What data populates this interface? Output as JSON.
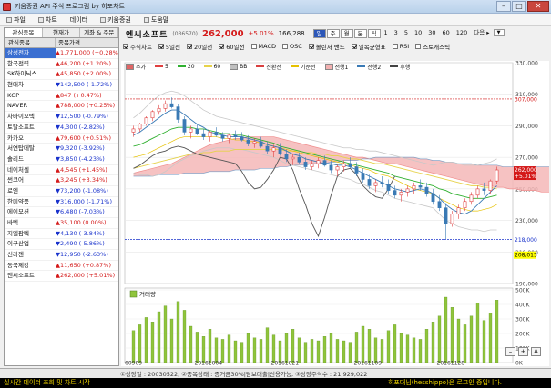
{
  "window": {
    "title": "키움증권 API 주식 프로그램 by 히포차트"
  },
  "menu": [
    {
      "icon": "file-icon",
      "label": "파일"
    },
    {
      "icon": "chart-icon",
      "label": "차트"
    },
    {
      "icon": "data-icon",
      "label": "데이터"
    },
    {
      "icon": "kiwoom-icon",
      "label": "키움증권"
    },
    {
      "icon": "help-icon",
      "label": "도움말"
    }
  ],
  "left": {
    "tabs": [
      "관심종목",
      "현재가",
      "계좌 & 주문"
    ],
    "columns": [
      "관심종목",
      "종목가격"
    ],
    "rows": [
      {
        "name": "삼성전자",
        "price": "▲1,771,000 (+0.28%)",
        "dir": "up",
        "selected": true
      },
      {
        "name": "한국전력",
        "price": "▲46,200 (+1.20%)",
        "dir": "up"
      },
      {
        "name": "SK하이닉스",
        "price": "▲45,850 (+2.00%)",
        "dir": "up"
      },
      {
        "name": "현대차",
        "price": "▼142,500 (-1.72%)",
        "dir": "dn"
      },
      {
        "name": "KGP",
        "price": "▲847 (+0.47%)",
        "dir": "up"
      },
      {
        "name": "NAVER",
        "price": "▲788,000 (+0.25%)",
        "dir": "up"
      },
      {
        "name": "차바이오텍",
        "price": "▼12,500 (-0.79%)",
        "dir": "dn"
      },
      {
        "name": "토탈소프트",
        "price": "▼4,300 (-2.82%)",
        "dir": "dn"
      },
      {
        "name": "카카오",
        "price": "▲79,600 (+0.51%)",
        "dir": "up"
      },
      {
        "name": "서연탑메탈",
        "price": "▼9,320 (-3.92%)",
        "dir": "dn"
      },
      {
        "name": "솔리드",
        "price": "▼3,850 (-4.23%)",
        "dir": "dn"
      },
      {
        "name": "네이처셀",
        "price": "▲4,545 (+1.45%)",
        "dir": "up"
      },
      {
        "name": "썬코어",
        "price": "▲3,245 (+3.34%)",
        "dir": "up"
      },
      {
        "name": "로엔",
        "price": "▼73,200 (-1.08%)",
        "dir": "dn"
      },
      {
        "name": "한미약품",
        "price": "▼316,000 (-1.71%)",
        "dir": "dn"
      },
      {
        "name": "에이모션",
        "price": "▼6,480 (-7.03%)",
        "dir": "dn"
      },
      {
        "name": "바텍",
        "price": "▲35,100 (0.00%)",
        "dir": "up"
      },
      {
        "name": "지엘팜텍",
        "price": "▼4,130 (-3.84%)",
        "dir": "dn"
      },
      {
        "name": "이구산업",
        "price": "▼2,490 (-5.86%)",
        "dir": "dn"
      },
      {
        "name": "신라젠",
        "price": "▼12,950 (-2.63%)",
        "dir": "dn"
      },
      {
        "name": "동국제강",
        "price": "▲11,650 (+0.87%)",
        "dir": "up"
      },
      {
        "name": "엔씨소프트",
        "price": "▲262,000 (+5.01%)",
        "dir": "up"
      }
    ]
  },
  "header": {
    "name": "엔씨소프트",
    "code": "(036570)",
    "price": "262,000",
    "change": "+5.01%",
    "volume": "166,288",
    "periods": [
      "일",
      "주",
      "월",
      "분",
      "틱"
    ],
    "minutes": [
      "1",
      "3",
      "5",
      "10",
      "30",
      "60",
      "120"
    ],
    "after": "다음 ▸"
  },
  "options": [
    {
      "label": "주식차트",
      "on": true
    },
    {
      "label": "5일선",
      "on": true
    },
    {
      "label": "20일선",
      "on": true
    },
    {
      "label": "60일선",
      "on": true
    },
    {
      "label": "MACD",
      "on": false
    },
    {
      "label": "OSC",
      "on": false
    },
    {
      "label": "볼린저 밴드",
      "on": true
    },
    {
      "label": "일목균형표",
      "on": true
    },
    {
      "label": "RSI",
      "on": false
    },
    {
      "label": "스토캐스틱",
      "on": false
    }
  ],
  "legend": [
    {
      "label": "주가",
      "color": "#e06666",
      "kind": "box"
    },
    {
      "label": "5",
      "color": "#e04040"
    },
    {
      "label": "20",
      "color": "#30b030"
    },
    {
      "label": "60",
      "color": "#e6d24a"
    },
    {
      "label": "BB",
      "color": "#c0c0c0",
      "kind": "box"
    },
    {
      "label": "전환선",
      "color": "#d94040"
    },
    {
      "label": "기준선",
      "color": "#e6c100"
    },
    {
      "label": "선행1",
      "color": "#f3b1b1",
      "kind": "box"
    },
    {
      "label": "선행2",
      "color": "#3a7ab5"
    },
    {
      "label": "후행",
      "color": "#444444"
    }
  ],
  "chart_data": {
    "type": "candlestick",
    "ylim": [
      190000,
      330000
    ],
    "yticks": [
      "330,000",
      "310,000",
      "290,000",
      "270,000",
      "250,000",
      "230,000",
      "210,000",
      "190,000"
    ],
    "xticks": [
      "60909",
      "20161004",
      "20161021",
      "20161109",
      "20161128"
    ],
    "ref_lines": [
      {
        "label": "307,000",
        "value": 307000,
        "color": "#d41a1a"
      },
      {
        "label": "218,000",
        "value": 218000,
        "color": "#1a33cc"
      }
    ],
    "price_tags": [
      {
        "label": "262,000",
        "sub": "+5.01%",
        "value": 262000,
        "bg": "#d41a1a",
        "fg": "#ffffff"
      },
      {
        "label": "208,015",
        "value": 208015,
        "bg": "#ffff00",
        "fg": "#000000"
      }
    ],
    "candles": [
      [
        286000,
        290000,
        283000,
        288000
      ],
      [
        288000,
        292000,
        286000,
        291000
      ],
      [
        291000,
        296000,
        290000,
        295000
      ],
      [
        295000,
        300000,
        293000,
        299000
      ],
      [
        299000,
        303000,
        297000,
        301000
      ],
      [
        301000,
        306000,
        299000,
        304000
      ],
      [
        304000,
        308000,
        301000,
        302000
      ],
      [
        302000,
        304000,
        292000,
        294000
      ],
      [
        294000,
        296000,
        284000,
        286000
      ],
      [
        286000,
        290000,
        282000,
        288000
      ],
      [
        288000,
        291000,
        284000,
        285000
      ],
      [
        285000,
        288000,
        281000,
        283000
      ],
      [
        283000,
        287000,
        280000,
        286000
      ],
      [
        286000,
        289000,
        283000,
        284000
      ],
      [
        284000,
        286000,
        280000,
        282000
      ],
      [
        282000,
        285000,
        279000,
        284000
      ],
      [
        284000,
        287000,
        281000,
        283000
      ],
      [
        283000,
        286000,
        280000,
        281000
      ],
      [
        281000,
        284000,
        277000,
        279000
      ],
      [
        279000,
        282000,
        276000,
        280000
      ],
      [
        280000,
        283000,
        276000,
        277000
      ],
      [
        277000,
        280000,
        272000,
        274000
      ],
      [
        274000,
        278000,
        270000,
        276000
      ],
      [
        276000,
        279000,
        271000,
        272000
      ],
      [
        272000,
        275000,
        267000,
        269000
      ],
      [
        269000,
        272000,
        265000,
        270000
      ],
      [
        270000,
        273000,
        266000,
        267000
      ],
      [
        267000,
        270000,
        262000,
        264000
      ],
      [
        264000,
        268000,
        262000,
        266000
      ],
      [
        266000,
        270000,
        263000,
        268000
      ],
      [
        268000,
        271000,
        264000,
        265000
      ],
      [
        265000,
        268000,
        260000,
        262000
      ],
      [
        262000,
        266000,
        258000,
        264000
      ],
      [
        264000,
        268000,
        261000,
        266000
      ],
      [
        266000,
        270000,
        263000,
        264000
      ],
      [
        264000,
        267000,
        258000,
        260000
      ],
      [
        260000,
        263000,
        254000,
        256000
      ],
      [
        256000,
        259000,
        250000,
        252000
      ],
      [
        252000,
        256000,
        248000,
        254000
      ],
      [
        254000,
        258000,
        251000,
        253000
      ],
      [
        253000,
        256000,
        247000,
        249000
      ],
      [
        249000,
        252000,
        244000,
        246000
      ],
      [
        246000,
        250000,
        242000,
        248000
      ],
      [
        248000,
        252000,
        245000,
        250000
      ],
      [
        250000,
        254000,
        247000,
        252000
      ],
      [
        252000,
        256000,
        249000,
        251000
      ],
      [
        251000,
        254000,
        245000,
        247000
      ],
      [
        247000,
        250000,
        240000,
        242000
      ],
      [
        242000,
        246000,
        236000,
        238000
      ],
      [
        238000,
        241000,
        218000,
        228000
      ],
      [
        228000,
        236000,
        226000,
        234000
      ],
      [
        234000,
        240000,
        231000,
        238000
      ],
      [
        238000,
        244000,
        236000,
        242000
      ],
      [
        242000,
        248000,
        240000,
        246000
      ],
      [
        246000,
        252000,
        244000,
        250000
      ],
      [
        250000,
        254000,
        246000,
        249000
      ],
      [
        249000,
        256000,
        247000,
        255000
      ],
      [
        255000,
        264000,
        253000,
        262000
      ]
    ],
    "ma5": [
      284000,
      286000,
      289000,
      292000,
      295000,
      298000,
      300000,
      300000,
      297000,
      294000,
      291000,
      289000,
      286000,
      285000,
      284000,
      283000,
      283000,
      283000,
      282000,
      281000,
      280000,
      278000,
      277000,
      276000,
      274000,
      272000,
      271000,
      269000,
      268000,
      267000,
      266000,
      266000,
      265000,
      265000,
      264000,
      262000,
      260000,
      258000,
      256000,
      254000,
      252000,
      250000,
      249000,
      248000,
      249000,
      250000,
      249000,
      247000,
      244000,
      240000,
      237000,
      235000,
      234000,
      236000,
      240000,
      244000,
      248000,
      252000
    ],
    "ma20": [
      277000,
      278000,
      280000,
      282000,
      284000,
      286000,
      288000,
      289000,
      289000,
      289000,
      288000,
      288000,
      287000,
      286000,
      285000,
      285000,
      284000,
      284000,
      283000,
      282000,
      281000,
      280000,
      279000,
      277000,
      276000,
      275000,
      274000,
      273000,
      272000,
      271000,
      270000,
      269000,
      268000,
      267000,
      266000,
      265000,
      264000,
      263000,
      262000,
      261000,
      260000,
      258000,
      257000,
      256000,
      255000,
      254000,
      253000,
      252000,
      250000,
      249000,
      247000,
      246000,
      245000,
      244000,
      244000,
      244000,
      245000,
      246000
    ],
    "ma60": [
      263000,
      264000,
      265000,
      266000,
      267000,
      268000,
      269000,
      270000,
      271000,
      272000,
      272000,
      273000,
      273000,
      274000,
      274000,
      274000,
      275000,
      275000,
      275000,
      275000,
      275000,
      275000,
      275000,
      275000,
      274000,
      274000,
      274000,
      273000,
      273000,
      272000,
      272000,
      271000,
      271000,
      270000,
      269000,
      269000,
      268000,
      267000,
      266000,
      266000,
      265000,
      264000,
      263000,
      262000,
      261000,
      260000,
      259000,
      258000,
      257000,
      256000,
      255000,
      254000,
      253000,
      252000,
      252000,
      251000,
      251000,
      250000
    ],
    "bb_upper": [
      295000,
      298000,
      302000,
      306000,
      309000,
      311000,
      312000,
      311000,
      309000,
      306000,
      303000,
      300000,
      298000,
      296000,
      295000,
      294000,
      293000,
      292000,
      291000,
      290000,
      289000,
      288000,
      287000,
      286000,
      285000,
      284000,
      283000,
      282000,
      281000,
      280000,
      279000,
      278000,
      277000,
      276000,
      276000,
      275000,
      275000,
      274000,
      274000,
      273000,
      272000,
      271000,
      270000,
      269000,
      268000,
      267000,
      266000,
      265000,
      266000,
      267000,
      267000,
      266000,
      265000,
      265000,
      265000,
      266000,
      267000,
      269000
    ],
    "bb_lower": [
      260000,
      259000,
      259000,
      258000,
      259000,
      261000,
      264000,
      267000,
      269000,
      271000,
      272000,
      274000,
      275000,
      276000,
      276000,
      276000,
      275000,
      275000,
      274000,
      273000,
      272000,
      271000,
      270000,
      268000,
      266000,
      265000,
      264000,
      263000,
      262000,
      261000,
      260000,
      259000,
      258000,
      257000,
      256000,
      254000,
      253000,
      251000,
      249000,
      248000,
      246000,
      244000,
      243000,
      242000,
      241000,
      240000,
      239000,
      238000,
      234000,
      230000,
      228000,
      226000,
      225000,
      224000,
      224000,
      223000,
      224000,
      224000
    ],
    "kijun": [
      270000,
      271000,
      272000,
      274000,
      276000,
      278000,
      280000,
      282000,
      283000,
      283000,
      283000,
      283000,
      283000,
      283000,
      282000,
      282000,
      281000,
      281000,
      280000,
      280000,
      279000,
      278000,
      277000,
      276000,
      275000,
      274000,
      273000,
      272000,
      271000,
      270000,
      269000,
      268000,
      267000,
      266000,
      265000,
      264000,
      263000,
      262000,
      260000,
      259000,
      258000,
      256000,
      254000,
      252000,
      250000,
      249000,
      248000,
      247000,
      244000,
      242000,
      240000,
      238000,
      237000,
      236000,
      236000,
      237000,
      238000,
      240000
    ],
    "chikou": [
      263000,
      265000,
      268000,
      271000,
      273000,
      274000,
      276000,
      277000,
      276000,
      274000,
      272000,
      271000,
      270000,
      269000,
      268000,
      267000,
      266000,
      261000,
      254000,
      250000,
      251000,
      256000,
      262000,
      270000,
      269000,
      262000,
      250000,
      240000,
      228000,
      220000,
      232000,
      246000,
      258000,
      262000,
      263000,
      259000,
      252000,
      248000,
      245000,
      244000,
      250000,
      258000
    ],
    "cloud_a": [
      260000,
      261000,
      262000,
      263000,
      264000,
      265000,
      266000,
      268000,
      270000,
      272000,
      274000,
      276000,
      278000,
      279000,
      280000,
      281000,
      282000,
      282000,
      283000,
      283000,
      283000,
      283000,
      283000,
      282000,
      281000,
      280000,
      279000,
      278000,
      277000,
      276000,
      275000,
      274000,
      273000,
      272000,
      271000,
      270000,
      270000,
      269000,
      268000,
      267000,
      266000,
      266000,
      265000,
      264000,
      263000,
      262000,
      261000,
      260000,
      259000,
      258000,
      257000,
      256000,
      255000,
      254000,
      253000,
      252000,
      252000,
      251000,
      251000,
      250000,
      250000,
      249000,
      249000,
      249000,
      248000,
      248000,
      248000
    ],
    "cloud_b": [
      258000,
      258000,
      258000,
      258000,
      259000,
      259000,
      259000,
      259000,
      260000,
      260000,
      260000,
      260000,
      261000,
      261000,
      261000,
      261000,
      262000,
      262000,
      262000,
      262000,
      263000,
      263000,
      263000,
      264000,
      264000,
      265000,
      265000,
      265000,
      266000,
      266000,
      266000,
      267000,
      267000,
      268000,
      268000,
      268000,
      269000,
      269000,
      270000,
      270000,
      270000,
      270000,
      270000,
      270000,
      270000,
      269000,
      269000,
      268000,
      268000,
      267000,
      267000,
      266000,
      266000,
      266000,
      265000,
      265000,
      265000,
      265000,
      264000,
      264000,
      264000,
      264000,
      264000,
      264000,
      264000,
      264000,
      264000
    ],
    "volume_panel": {
      "label": "거래량",
      "ylim": [
        0,
        500000
      ],
      "yticks": [
        "500K",
        "400K",
        "300K",
        "200K",
        "100K",
        "0K"
      ]
    },
    "volume": [
      220000,
      260000,
      310000,
      280000,
      350000,
      390000,
      300000,
      420000,
      360000,
      250000,
      210000,
      180000,
      230000,
      170000,
      160000,
      190000,
      150000,
      140000,
      200000,
      170000,
      160000,
      240000,
      190000,
      150000,
      200000,
      230000,
      170000,
      140000,
      160000,
      150000,
      180000,
      200000,
      160000,
      150000,
      140000,
      210000,
      250000,
      230000,
      170000,
      160000,
      220000,
      260000,
      200000,
      190000,
      170000,
      160000,
      230000,
      280000,
      320000,
      450000,
      380000,
      300000,
      260000,
      320000,
      410000,
      290000,
      340000,
      430000
    ]
  },
  "zoom": {
    "minus": "–",
    "plus": "+",
    "auto": "A"
  },
  "status": {
    "info": "①상장일 : 20030522, ②종목상태 : 증거금30%|담보대출|신용가능, ③상장주식수 : 21,929,022",
    "left": "실시간 데이터 조회 및 차트 시작",
    "right": "히포대님(hesshippo)은 로그인 중입니다."
  }
}
